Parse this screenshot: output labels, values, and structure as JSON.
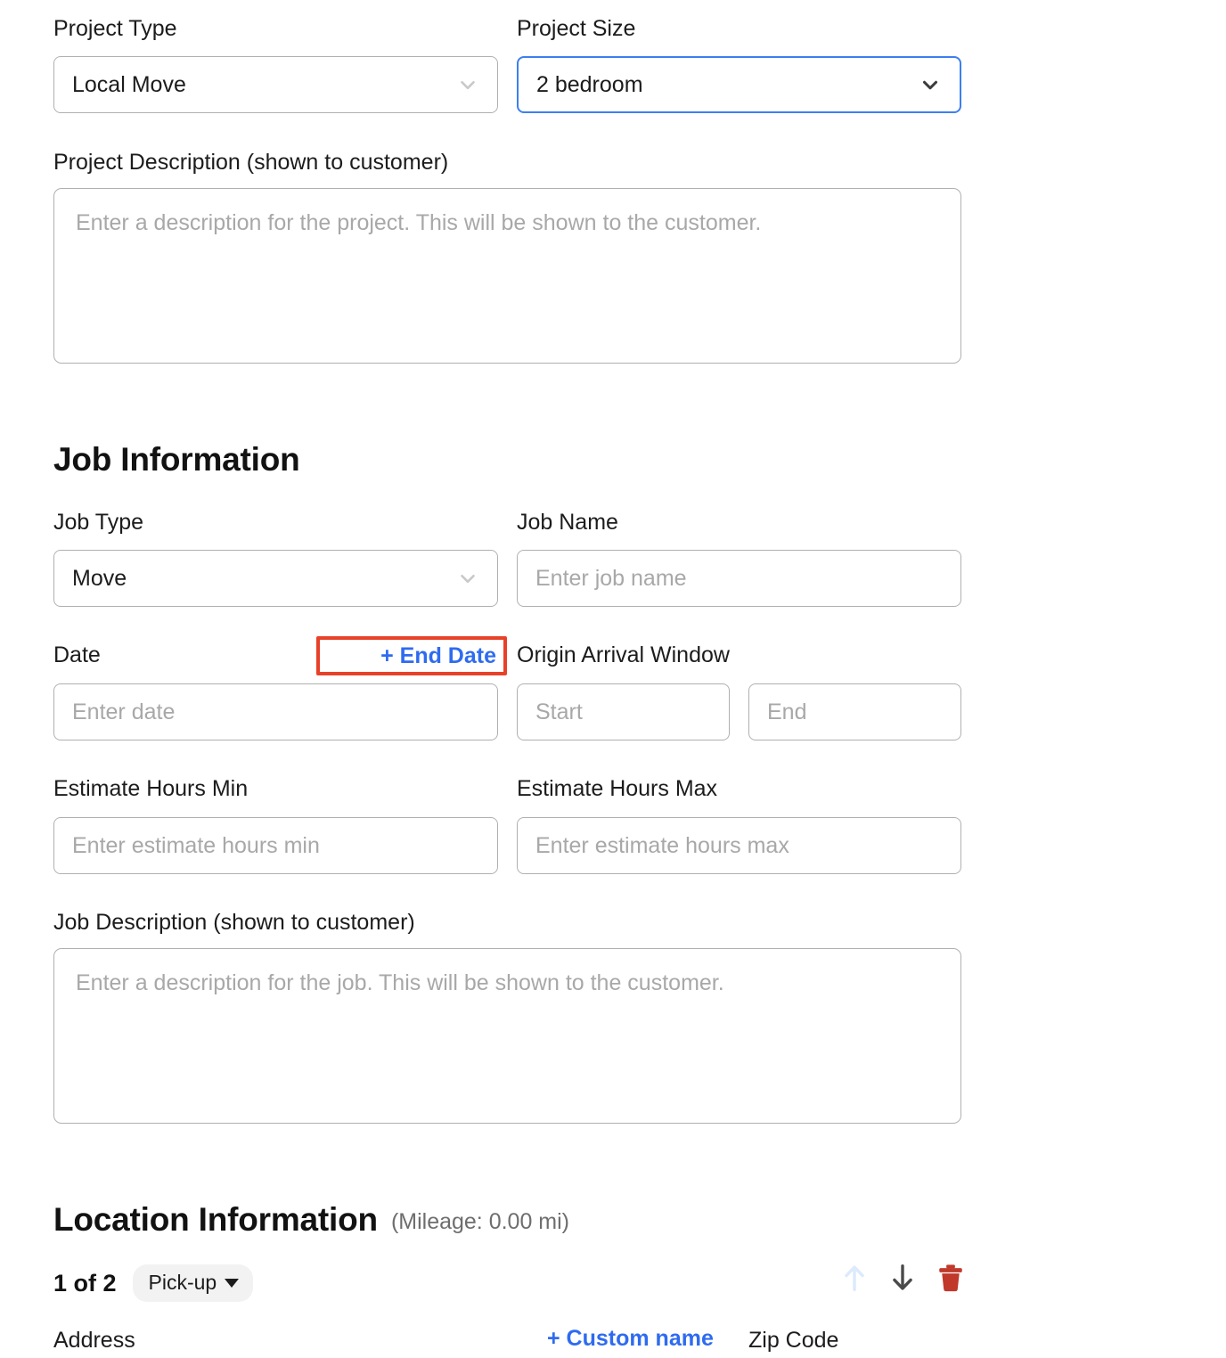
{
  "project": {
    "type_label": "Project Type",
    "type_value": "Local Move",
    "size_label": "Project Size",
    "size_value": "2 bedroom",
    "description_label": "Project Description (shown to customer)",
    "description_placeholder": "Enter a description for the project. This will be shown to the customer."
  },
  "job": {
    "heading": "Job Information",
    "type_label": "Job Type",
    "type_value": "Move",
    "name_label": "Job Name",
    "name_placeholder": "Enter job name",
    "date_label": "Date",
    "end_date_link": "+ End Date",
    "date_placeholder": "Enter date",
    "arrival_window_label": "Origin Arrival Window",
    "arrival_start_placeholder": "Start",
    "arrival_end_placeholder": "End",
    "hours_min_label": "Estimate Hours Min",
    "hours_min_placeholder": "Enter estimate hours min",
    "hours_max_label": "Estimate Hours Max",
    "hours_max_placeholder": "Enter estimate hours max",
    "description_label": "Job Description (shown to customer)",
    "description_placeholder": "Enter a description for the job. This will be shown to the customer."
  },
  "location": {
    "heading": "Location Information",
    "mileage": "(Mileage: 0.00 mi)",
    "counter": "1 of 2",
    "stop_type": "Pick-up",
    "address_label": "Address",
    "custom_name_link": "+ Custom name",
    "zip_label": "Zip Code"
  },
  "colors": {
    "accent_blue": "#2f6bf0",
    "focus_blue": "#3d7ff0",
    "highlight_red": "#e8412a",
    "danger_red": "#c0392b",
    "arrow_disabled": "#d9e8fb",
    "arrow_active": "#4a4a4a"
  }
}
